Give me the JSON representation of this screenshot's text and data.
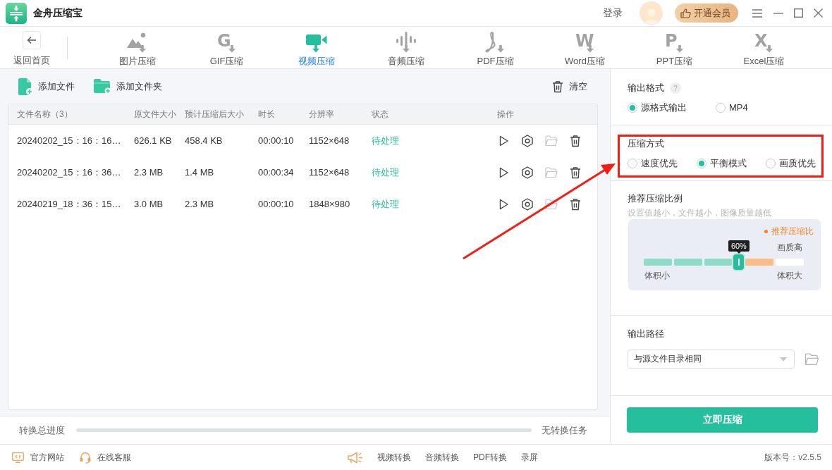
{
  "title_bar": {
    "title": "金舟压缩宝",
    "login": "登录",
    "vip_button": "开通会员"
  },
  "nav": {
    "back": "返回首页",
    "tabs": [
      {
        "label": "图片压缩",
        "kind": "image",
        "selected": false
      },
      {
        "label": "GIF压缩",
        "kind": "letter",
        "glyph": "G",
        "selected": false
      },
      {
        "label": "视频压缩",
        "kind": "video",
        "selected": true
      },
      {
        "label": "音频压缩",
        "kind": "audio",
        "selected": false
      },
      {
        "label": "PDF压缩",
        "kind": "pdf",
        "selected": false
      },
      {
        "label": "Word压缩",
        "kind": "letter",
        "glyph": "W",
        "selected": false
      },
      {
        "label": "PPT压缩",
        "kind": "letter",
        "glyph": "P",
        "selected": false
      },
      {
        "label": "Excel压缩",
        "kind": "letter",
        "glyph": "X",
        "selected": false
      }
    ]
  },
  "toolbar": {
    "add_file": "添加文件",
    "add_folder": "添加文件夹",
    "clear": "清空"
  },
  "table": {
    "columns": [
      "文件名称（3）",
      "原文件大小",
      "预计压缩后大小",
      "时长",
      "分辨率",
      "状态",
      "操作"
    ],
    "rows": [
      {
        "name": "20240202_15：16：16…",
        "original_size": "626.1 KB",
        "estimated_size": "458.4 KB",
        "duration": "00:00:10",
        "resolution": "1152×648",
        "status": "待处理",
        "folder_disabled": true
      },
      {
        "name": "20240202_15：16：36…",
        "original_size": "2.3 MB",
        "estimated_size": "1.4 MB",
        "duration": "00:00:34",
        "resolution": "1152×648",
        "status": "待处理",
        "folder_disabled": true
      },
      {
        "name": "20240219_18：36：15…",
        "original_size": "3.0 MB",
        "estimated_size": "2.3 MB",
        "duration": "00:00:10",
        "resolution": "1848×980",
        "status": "待处理",
        "folder_disabled": true
      }
    ]
  },
  "progress": {
    "label": "转换总进度",
    "status": "无转换任务"
  },
  "settings": {
    "output_format": {
      "title": "输出格式",
      "help": "?",
      "options": [
        {
          "label": "源格式输出",
          "selected": true
        },
        {
          "label": "MP4",
          "selected": false
        }
      ]
    },
    "compression_mode": {
      "title": "压缩方式",
      "highlighted": true,
      "options": [
        {
          "label": "速度优先",
          "selected": false
        },
        {
          "label": "平衡模式",
          "selected": true
        },
        {
          "label": "画质优先",
          "selected": false
        }
      ]
    },
    "ratio": {
      "title": "推荐压缩比例",
      "hint": "设置值越小，文件越小，图像质量越低",
      "legend": "推荐压缩比",
      "reading": "60%",
      "level": 0.6,
      "top_label": "画质高",
      "min_label": "体积小",
      "max_label": "体积大",
      "segments": [
        {
          "recommended": false
        },
        {
          "recommended": false
        },
        {
          "recommended": false
        },
        {
          "recommended": true
        },
        {
          "recommended": false
        }
      ]
    },
    "output_path": {
      "title": "输出路径",
      "value": "与源文件目录相同"
    },
    "start_button": "立即压缩"
  },
  "footer": {
    "links": [
      {
        "label": "官方网站",
        "kind": "website"
      },
      {
        "label": "在线客服",
        "kind": "support"
      }
    ],
    "promos": [
      "视频转换",
      "音频转换",
      "PDF转换",
      "录屏"
    ],
    "version": "版本号：v2.5.5"
  }
}
